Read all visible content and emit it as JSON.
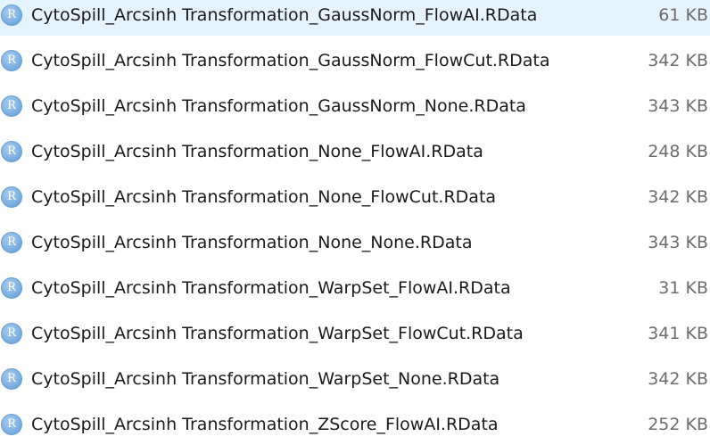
{
  "files": [
    {
      "name": "CytoSpill_Arcsinh Transformation_GaussNorm_FlowAI.RData",
      "size": "61 KB",
      "icon": "r-file-icon",
      "icon_letter": "R"
    },
    {
      "name": "CytoSpill_Arcsinh Transformation_GaussNorm_FlowCut.RData",
      "size": "342 KB",
      "icon": "r-file-icon",
      "icon_letter": "R"
    },
    {
      "name": "CytoSpill_Arcsinh Transformation_GaussNorm_None.RData",
      "size": "343 KB",
      "icon": "r-file-icon",
      "icon_letter": "R"
    },
    {
      "name": "CytoSpill_Arcsinh Transformation_None_FlowAI.RData",
      "size": "248 KB",
      "icon": "r-file-icon",
      "icon_letter": "R"
    },
    {
      "name": "CytoSpill_Arcsinh Transformation_None_FlowCut.RData",
      "size": "342 KB",
      "icon": "r-file-icon",
      "icon_letter": "R"
    },
    {
      "name": "CytoSpill_Arcsinh Transformation_None_None.RData",
      "size": "343 KB",
      "icon": "r-file-icon",
      "icon_letter": "R"
    },
    {
      "name": "CytoSpill_Arcsinh Transformation_WarpSet_FlowAI.RData",
      "size": "31 KB",
      "icon": "r-file-icon",
      "icon_letter": "R"
    },
    {
      "name": "CytoSpill_Arcsinh Transformation_WarpSet_FlowCut.RData",
      "size": "341 KB",
      "icon": "r-file-icon",
      "icon_letter": "R"
    },
    {
      "name": "CytoSpill_Arcsinh Transformation_WarpSet_None.RData",
      "size": "342 KB",
      "icon": "r-file-icon",
      "icon_letter": "R"
    },
    {
      "name": "CytoSpill_Arcsinh Transformation_ZScore_FlowAI.RData",
      "size": "252 KB",
      "icon": "r-file-icon",
      "icon_letter": "R"
    }
  ],
  "colors": {
    "icon_fill": "#7fb2e3",
    "name_text": "#1a1a1a",
    "size_text": "#6d6d6d"
  }
}
